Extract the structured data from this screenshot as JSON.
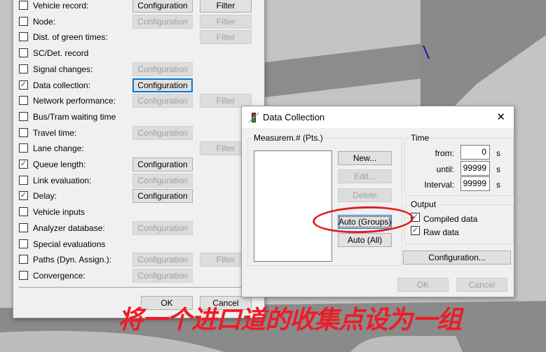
{
  "evaluations": {
    "rows": [
      {
        "label": "Vehicle record:",
        "checked": false,
        "config": "enabled",
        "filter": "enabled"
      },
      {
        "label": "Node:",
        "checked": false,
        "config": "disabled",
        "filter": "disabled"
      },
      {
        "label": "Dist. of green times:",
        "checked": false,
        "config": null,
        "filter": "disabled"
      },
      {
        "label": "SC/Det. record",
        "checked": false,
        "config": null,
        "filter": null
      },
      {
        "label": "Signal changes:",
        "checked": false,
        "config": "disabled",
        "filter": null
      },
      {
        "label": "Data collection:",
        "checked": true,
        "config": "focused",
        "filter": null
      },
      {
        "label": "Network performance:",
        "checked": false,
        "config": "disabled",
        "filter": "disabled"
      },
      {
        "label": "Bus/Tram waiting time",
        "checked": false,
        "config": null,
        "filter": null
      },
      {
        "label": "Travel time:",
        "checked": false,
        "config": "disabled",
        "filter": null
      },
      {
        "label": "Lane change:",
        "checked": false,
        "config": null,
        "filter": "disabled"
      },
      {
        "label": "Queue length:",
        "checked": true,
        "config": "enabled",
        "filter": null
      },
      {
        "label": "Link evaluation:",
        "checked": false,
        "config": "disabled",
        "filter": null
      },
      {
        "label": "Delay:",
        "checked": true,
        "config": "enabled",
        "filter": null
      },
      {
        "label": "Vehicle inputs",
        "checked": false,
        "config": null,
        "filter": null
      },
      {
        "label": "Analyzer database:",
        "checked": false,
        "config": "disabled",
        "filter": null
      },
      {
        "label": "Special evaluations",
        "checked": false,
        "config": null,
        "filter": null
      },
      {
        "label": "Paths (Dyn. Assign.):",
        "checked": false,
        "config": "disabled",
        "filter": "disabled"
      },
      {
        "label": "Convergence:",
        "checked": false,
        "config": "disabled",
        "filter": null
      }
    ],
    "config_label": "Configuration",
    "filter_label": "Filter",
    "ok": "OK",
    "cancel": "Cancel"
  },
  "data_collection": {
    "title": "Data Collection",
    "close": "✕",
    "list_group": "Measurem.# (Pts.)",
    "new": "New...",
    "edit": "Edit...",
    "delete": "Delete",
    "auto_groups": "Auto (Groups)",
    "auto_all": "Auto (All)",
    "time_group": "Time",
    "from_label": "from:",
    "from_value": "0",
    "until_label": "until:",
    "until_value": "99999",
    "interval_label": "Interval:",
    "interval_value": "99999",
    "unit": "s",
    "output_group": "Output",
    "compiled": "Compiled data",
    "compiled_checked": true,
    "raw": "Raw data",
    "raw_checked": true,
    "configuration": "Configuration...",
    "ok": "OK",
    "cancel": "Cancel"
  },
  "annotation": {
    "text": "将一个进口道的收集点设为一组",
    "color": "#ee1c25"
  }
}
